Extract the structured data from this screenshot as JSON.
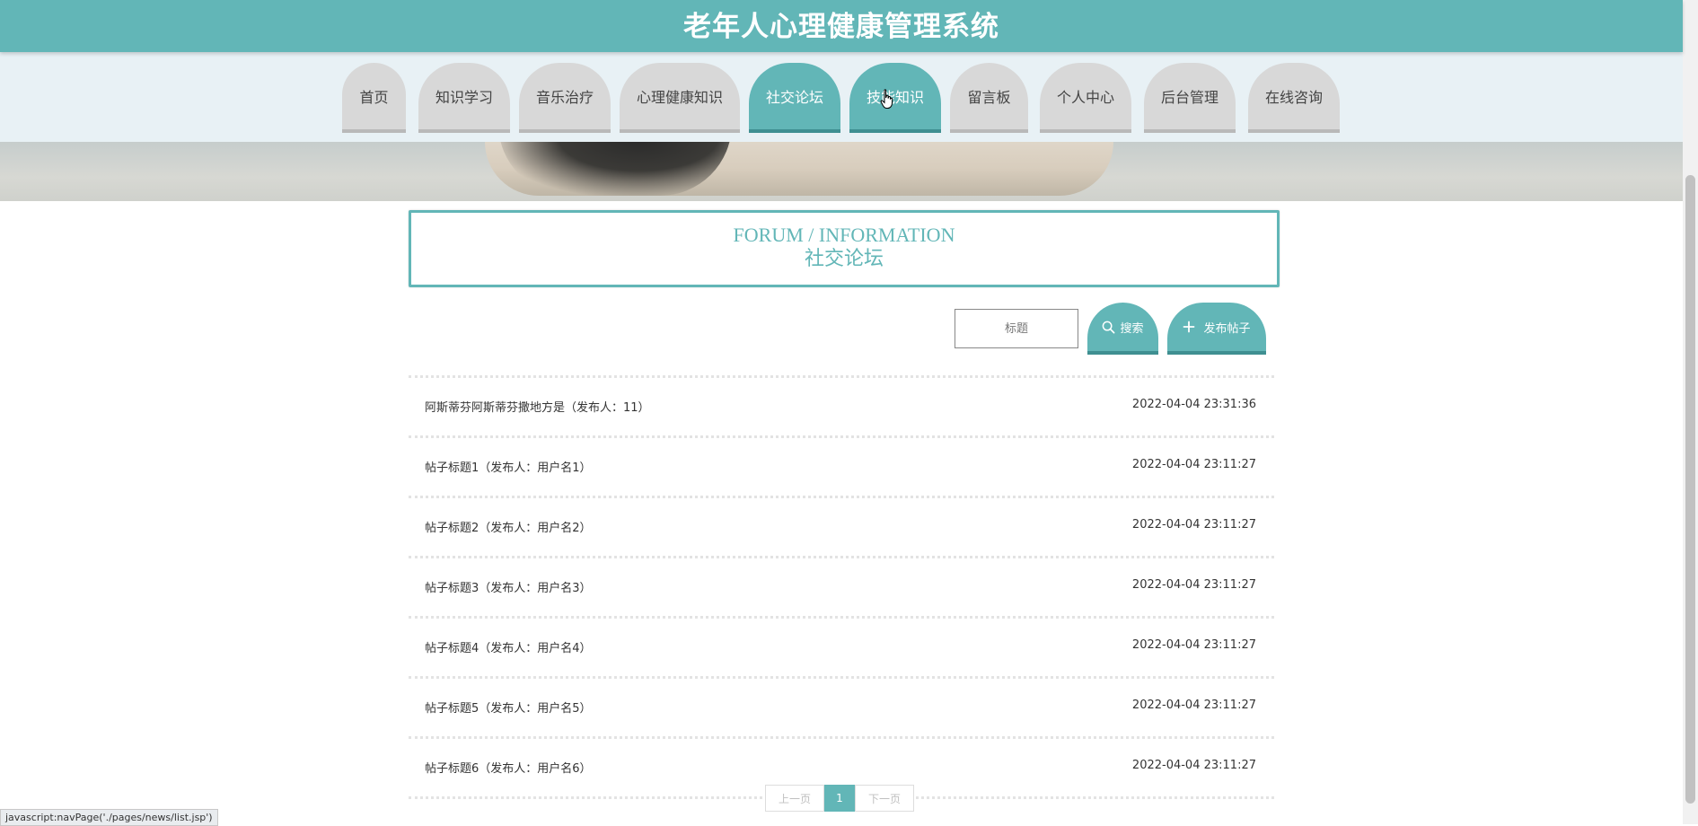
{
  "header": {
    "title": "老年人心理健康管理系统"
  },
  "nav": {
    "items": [
      {
        "label": "首页"
      },
      {
        "label": "知识学习"
      },
      {
        "label": "音乐治疗"
      },
      {
        "label": "心理健康知识"
      },
      {
        "label": "社交论坛"
      },
      {
        "label": "技能知识"
      },
      {
        "label": "留言板"
      },
      {
        "label": "个人中心"
      },
      {
        "label": "后台管理"
      },
      {
        "label": "在线咨询"
      }
    ],
    "active_items": [
      "社交论坛",
      "技能知识"
    ]
  },
  "section": {
    "title_en": "FORUM / INFORMATION",
    "title_cn": "社交论坛"
  },
  "search": {
    "placeholder": "标题",
    "search_label": "搜索",
    "search_icon": "search-icon",
    "post_label": "发布帖子",
    "post_icon": "plus-icon"
  },
  "posts": [
    {
      "title": "阿斯蒂芬阿斯蒂芬撒地方是（发布人：11）",
      "date": "2022-04-04 23:31:36"
    },
    {
      "title": "帖子标题1（发布人：用户名1）",
      "date": "2022-04-04 23:11:27"
    },
    {
      "title": "帖子标题2（发布人：用户名2）",
      "date": "2022-04-04 23:11:27"
    },
    {
      "title": "帖子标题3（发布人：用户名3）",
      "date": "2022-04-04 23:11:27"
    },
    {
      "title": "帖子标题4（发布人：用户名4）",
      "date": "2022-04-04 23:11:27"
    },
    {
      "title": "帖子标题5（发布人：用户名5）",
      "date": "2022-04-04 23:11:27"
    },
    {
      "title": "帖子标题6（发布人：用户名6）",
      "date": "2022-04-04 23:11:27"
    }
  ],
  "pagination": {
    "prev_label": "上一页",
    "current_page": "1",
    "next_label": "下一页"
  },
  "status_bar": {
    "link": "javascript:navPage('./pages/news/list.jsp')"
  },
  "colors": {
    "accent": "#62b6b7",
    "accent_dark": "#3f8f91",
    "nav_inactive": "#d8d8d8",
    "nav_bg": "#e8f1f5"
  }
}
